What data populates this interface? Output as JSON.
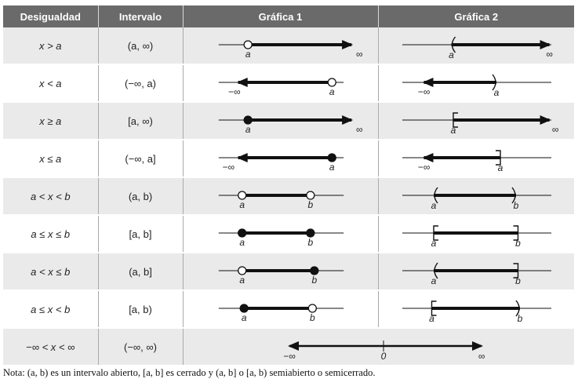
{
  "headers": {
    "desigualdad": "Desigualdad",
    "intervalo": "Intervalo",
    "grafica1": "Gráfica 1",
    "grafica2": "Gráfica 2"
  },
  "rows": [
    {
      "desigualdad": "x > a",
      "intervalo": "(a, ∞)",
      "g1": {
        "segment": [
          0.33,
          0.86
        ],
        "arrow": "right",
        "points": [
          {
            "x": 0.33,
            "closed": false,
            "label": "a"
          }
        ],
        "ends": [
          {
            "x": 0.9,
            "label": "∞"
          }
        ]
      },
      "g2": {
        "segment": [
          0.37,
          0.87
        ],
        "arrow": "right",
        "brackets": [
          {
            "x": 0.37,
            "dir": "left",
            "closed": false,
            "label": "a"
          }
        ],
        "ends": [
          {
            "x": 0.87,
            "label": "∞"
          }
        ]
      }
    },
    {
      "desigualdad": "x < a",
      "intervalo": "(−∞, a)",
      "g1": {
        "segment": [
          0.28,
          0.76
        ],
        "arrow": "left",
        "points": [
          {
            "x": 0.76,
            "closed": false,
            "label": "a"
          }
        ],
        "ends": [
          {
            "x": 0.26,
            "label": "−∞"
          }
        ]
      },
      "g2": {
        "segment": [
          0.23,
          0.6
        ],
        "arrow": "left",
        "brackets": [
          {
            "x": 0.6,
            "dir": "right",
            "closed": false,
            "label": "a"
          }
        ],
        "ends": [
          {
            "x": 0.23,
            "label": "−∞"
          }
        ]
      }
    },
    {
      "desigualdad": "x ≥ a",
      "intervalo": "[a, ∞)",
      "g1": {
        "segment": [
          0.33,
          0.86
        ],
        "arrow": "right",
        "points": [
          {
            "x": 0.33,
            "closed": true,
            "label": "a"
          }
        ],
        "ends": [
          {
            "x": 0.9,
            "label": "∞"
          }
        ]
      },
      "g2": {
        "segment": [
          0.38,
          0.87
        ],
        "arrow": "right",
        "brackets": [
          {
            "x": 0.38,
            "dir": "left",
            "closed": true,
            "label": "a"
          }
        ],
        "ends": [
          {
            "x": 0.9,
            "label": "∞"
          }
        ]
      }
    },
    {
      "desigualdad": "x ≤ a",
      "intervalo": "(−∞, a]",
      "g1": {
        "segment": [
          0.28,
          0.76
        ],
        "arrow": "left",
        "points": [
          {
            "x": 0.76,
            "closed": true,
            "label": "a"
          }
        ],
        "ends": [
          {
            "x": 0.23,
            "label": "−∞"
          }
        ]
      },
      "g2": {
        "segment": [
          0.23,
          0.62
        ],
        "arrow": "left",
        "brackets": [
          {
            "x": 0.62,
            "dir": "right",
            "closed": true,
            "label": "a"
          }
        ],
        "ends": [
          {
            "x": 0.23,
            "label": "−∞"
          }
        ]
      }
    },
    {
      "desigualdad": "a < x < b",
      "intervalo": "(a, b)",
      "g1": {
        "segment": [
          0.3,
          0.65
        ],
        "arrow": "none",
        "points": [
          {
            "x": 0.3,
            "closed": false,
            "label": "a"
          },
          {
            "x": 0.65,
            "closed": false,
            "label": "b"
          }
        ],
        "ends": []
      },
      "g2": {
        "segment": [
          0.28,
          0.7
        ],
        "arrow": "none",
        "brackets": [
          {
            "x": 0.28,
            "dir": "left",
            "closed": false,
            "label": "a"
          },
          {
            "x": 0.7,
            "dir": "right",
            "closed": false,
            "label": "b"
          }
        ],
        "ends": []
      }
    },
    {
      "desigualdad": "a ≤ x ≤ b",
      "intervalo": "[a, b]",
      "g1": {
        "segment": [
          0.3,
          0.65
        ],
        "arrow": "none",
        "points": [
          {
            "x": 0.3,
            "closed": true,
            "label": "a"
          },
          {
            "x": 0.65,
            "closed": true,
            "label": "b"
          }
        ],
        "ends": []
      },
      "g2": {
        "segment": [
          0.28,
          0.71
        ],
        "arrow": "none",
        "brackets": [
          {
            "x": 0.28,
            "dir": "left",
            "closed": true,
            "label": "a"
          },
          {
            "x": 0.71,
            "dir": "right",
            "closed": true,
            "label": "b"
          }
        ],
        "ends": []
      }
    },
    {
      "desigualdad": "a < x ≤ b",
      "intervalo": "(a, b]",
      "g1": {
        "segment": [
          0.3,
          0.67
        ],
        "arrow": "none",
        "points": [
          {
            "x": 0.3,
            "closed": false,
            "label": "a"
          },
          {
            "x": 0.67,
            "closed": true,
            "label": "b"
          }
        ],
        "ends": []
      },
      "g2": {
        "segment": [
          0.28,
          0.71
        ],
        "arrow": "none",
        "brackets": [
          {
            "x": 0.28,
            "dir": "left",
            "closed": false,
            "label": "a"
          },
          {
            "x": 0.71,
            "dir": "right",
            "closed": true,
            "label": "b"
          }
        ],
        "ends": []
      }
    },
    {
      "desigualdad": "a ≤ x < b",
      "intervalo": "[a, b)",
      "g1": {
        "segment": [
          0.31,
          0.66
        ],
        "arrow": "none",
        "points": [
          {
            "x": 0.31,
            "closed": true,
            "label": "a"
          },
          {
            "x": 0.66,
            "closed": false,
            "label": "b"
          }
        ],
        "ends": []
      },
      "g2": {
        "segment": [
          0.27,
          0.72
        ],
        "arrow": "none",
        "brackets": [
          {
            "x": 0.27,
            "dir": "left",
            "closed": true,
            "label": "a"
          },
          {
            "x": 0.72,
            "dir": "right",
            "closed": false,
            "label": "b"
          }
        ],
        "ends": []
      }
    },
    {
      "desigualdad": "−∞ < x < ∞",
      "intervalo": "(−∞, ∞)",
      "full": {
        "ends": [
          {
            "x": 0.27,
            "label": "−∞"
          },
          {
            "x": 0.76,
            "label": "∞"
          }
        ],
        "zero_label": "0",
        "zero_x": 0.51
      }
    }
  ],
  "note": "Nota: (a, b) es un intervalo abierto, [a, b] es cerrado y (a, b] o [a, b) semiabierto o semicerrado.",
  "colors": {
    "header_bg": "#6a6a6a",
    "header_text": "#ffffff",
    "row_shade": "#eaeaea",
    "line": "#111111"
  }
}
